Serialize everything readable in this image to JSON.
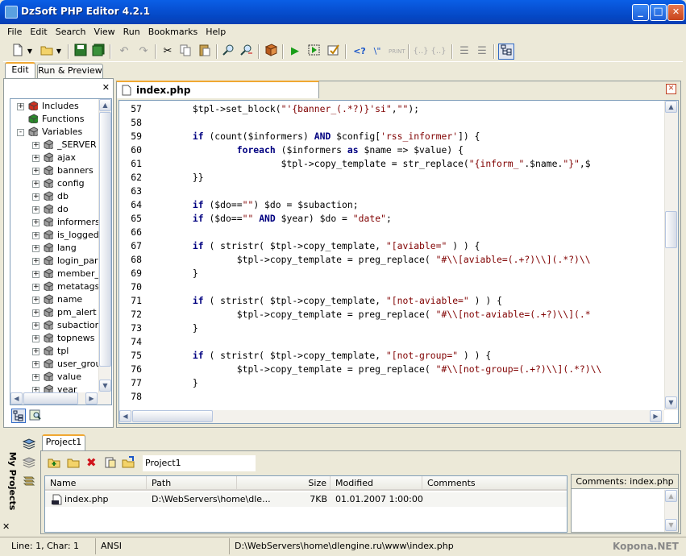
{
  "window": {
    "title": "DzSoft PHP Editor 4.2.1",
    "minimize": "_",
    "maximize": "□",
    "close": "✕"
  },
  "menu": [
    "File",
    "Edit",
    "Search",
    "View",
    "Run",
    "Bookmarks",
    "Help"
  ],
  "left_tabs": [
    "Edit",
    "Run & Preview"
  ],
  "left_close": "✕",
  "tree": [
    {
      "label": "Includes",
      "expander": "+",
      "level": 0,
      "icon": "includes-icon"
    },
    {
      "label": "Functions",
      "expander": "",
      "level": 0,
      "icon": "functions-icon"
    },
    {
      "label": "Variables",
      "expander": "-",
      "level": 0,
      "icon": "variables-icon"
    },
    {
      "label": "_SERVER",
      "expander": "+",
      "level": 1,
      "icon": "variable-icon"
    },
    {
      "label": "ajax",
      "expander": "+",
      "level": 1,
      "icon": "variable-icon"
    },
    {
      "label": "banners",
      "expander": "+",
      "level": 1,
      "icon": "variable-icon"
    },
    {
      "label": "config",
      "expander": "+",
      "level": 1,
      "icon": "variable-icon"
    },
    {
      "label": "db",
      "expander": "+",
      "level": 1,
      "icon": "variable-icon"
    },
    {
      "label": "do",
      "expander": "+",
      "level": 1,
      "icon": "variable-icon"
    },
    {
      "label": "informers",
      "expander": "+",
      "level": 1,
      "icon": "variable-icon"
    },
    {
      "label": "is_logged",
      "expander": "+",
      "level": 1,
      "icon": "variable-icon"
    },
    {
      "label": "lang",
      "expander": "+",
      "level": 1,
      "icon": "variable-icon"
    },
    {
      "label": "login_par",
      "expander": "+",
      "level": 1,
      "icon": "variable-icon"
    },
    {
      "label": "member_i",
      "expander": "+",
      "level": 1,
      "icon": "variable-icon"
    },
    {
      "label": "metatags",
      "expander": "+",
      "level": 1,
      "icon": "variable-icon"
    },
    {
      "label": "name",
      "expander": "+",
      "level": 1,
      "icon": "variable-icon"
    },
    {
      "label": "pm_alert",
      "expander": "+",
      "level": 1,
      "icon": "variable-icon"
    },
    {
      "label": "subaction",
      "expander": "+",
      "level": 1,
      "icon": "variable-icon"
    },
    {
      "label": "topnews",
      "expander": "+",
      "level": 1,
      "icon": "variable-icon"
    },
    {
      "label": "tpl",
      "expander": "+",
      "level": 1,
      "icon": "variable-icon"
    },
    {
      "label": "user_grou",
      "expander": "+",
      "level": 1,
      "icon": "variable-icon"
    },
    {
      "label": "value",
      "expander": "+",
      "level": 1,
      "icon": "variable-icon"
    },
    {
      "label": "year",
      "expander": "+",
      "level": 1,
      "icon": "variable-icon"
    }
  ],
  "editor": {
    "tab_label": "index.php",
    "close": "✕",
    "lines": [
      {
        "n": "57",
        "t": "        $tpl->set_block(\"'{banner_(.*?)}'si\",\"\");"
      },
      {
        "n": "58",
        "t": ""
      },
      {
        "n": "59",
        "t": "        if (count($informers) AND $config['rss_informer']) {"
      },
      {
        "n": "60",
        "t": "                foreach ($informers as $name => $value) {"
      },
      {
        "n": "61",
        "t": "                        $tpl->copy_template = str_replace(\"{inform_\".$name.\"}\",$"
      },
      {
        "n": "62",
        "t": "        }}"
      },
      {
        "n": "63",
        "t": ""
      },
      {
        "n": "64",
        "t": "        if ($do==\"\") $do = $subaction;"
      },
      {
        "n": "65",
        "t": "        if ($do==\"\" AND $year) $do = \"date\";"
      },
      {
        "n": "66",
        "t": ""
      },
      {
        "n": "67",
        "t": "        if ( stristr( $tpl->copy_template, \"[aviable=\" ) ) {"
      },
      {
        "n": "68",
        "t": "                $tpl->copy_template = preg_replace( \"#\\\\[aviable=(.+?)\\\\](.*?)\\\\"
      },
      {
        "n": "69",
        "t": "        }"
      },
      {
        "n": "70",
        "t": ""
      },
      {
        "n": "71",
        "t": "        if ( stristr( $tpl->copy_template, \"[not-aviable=\" ) ) {"
      },
      {
        "n": "72",
        "t": "                $tpl->copy_template = preg_replace( \"#\\\\[not-aviable=(.+?)\\\\](.*"
      },
      {
        "n": "73",
        "t": "        }"
      },
      {
        "n": "74",
        "t": ""
      },
      {
        "n": "75",
        "t": "        if ( stristr( $tpl->copy_template, \"[not-group=\" ) ) {"
      },
      {
        "n": "76",
        "t": "                $tpl->copy_template = preg_replace( \"#\\\\[not-group=(.+?)\\\\](.*?)\\\\"
      },
      {
        "n": "77",
        "t": "        }"
      },
      {
        "n": "78",
        "t": ""
      }
    ]
  },
  "projects": {
    "side_label": "My Projects",
    "tab": "Project1",
    "name_field": "Project1",
    "columns": [
      "Name",
      "Path",
      "Size",
      "Modified",
      "Comments"
    ],
    "rows": [
      {
        "name": "index.php",
        "path": "D:\\WebServers\\home\\dle...",
        "size": "7KB",
        "modified": "01.01.2007 1:00:00",
        "comments": ""
      }
    ],
    "comments_header": "Comments: index.php",
    "close": "✕"
  },
  "status": {
    "position": "Line: 1, Char: 1",
    "encoding": "ANSI",
    "path": "D:\\WebServers\\home\\dlengine.ru\\www\\index.php",
    "watermark": "Kopona.NET"
  }
}
